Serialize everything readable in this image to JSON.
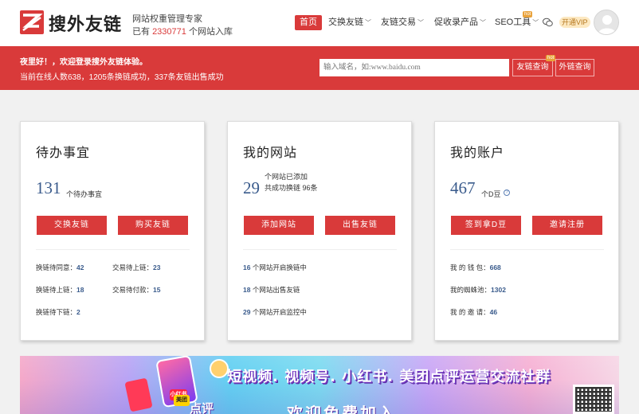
{
  "header": {
    "brand": "搜外友链",
    "slogan1": "网站权重管理专家",
    "slogan2_prefix": "已有",
    "slogan2_number": "2330771",
    "slogan2_suffix": "个网站入库",
    "nav": [
      {
        "label": "首页",
        "active": true
      },
      {
        "label": "交换友链",
        "dropdown": true
      },
      {
        "label": "友链交易",
        "dropdown": true
      },
      {
        "label": "促收录产品",
        "dropdown": true
      },
      {
        "label": "SEO工具",
        "dropdown": true
      }
    ],
    "hot_badge": "hot",
    "vip_label": "开通VIP",
    "accent_color": "#d93a3a"
  },
  "banner": {
    "greeting": "夜里好！，欢迎登录搜外友链体验。",
    "stats": "当前在线人数638，1205条换链成功，337条友链出售成功",
    "search_placeholder": "输入域名，如:www.baidu.com",
    "btn_friend": "友链查询",
    "btn_outer": "外链查询",
    "btn_hot": "hot"
  },
  "cards": {
    "todo": {
      "title": "待办事宜",
      "number": "131",
      "number_label": "个待办事宜",
      "btn1": "交换友链",
      "btn2": "购买友链",
      "stats": [
        {
          "label": "换链待同意：",
          "value": "42"
        },
        {
          "label": "交易待上链：",
          "value": "23"
        },
        {
          "label": "换链待上链：",
          "value": "18"
        },
        {
          "label": "交易待付款：",
          "value": "15"
        },
        {
          "label": "换链待下链：",
          "value": "2"
        }
      ]
    },
    "sites": {
      "title": "我的网站",
      "number": "29",
      "number_label1": "个网站已添加",
      "number_label2": "共成功换链 96条",
      "btn1": "添加网站",
      "btn2": "出售友链",
      "stats": [
        {
          "value": "16",
          "label": "个网站开启换链中"
        },
        {
          "value": "18",
          "label": "个网站出售友链"
        },
        {
          "value": "29",
          "label": "个网站开启监控中"
        }
      ]
    },
    "account": {
      "title": "我的账户",
      "number": "467",
      "number_label": "个D豆",
      "help": "?",
      "btn1": "签到拿D豆",
      "btn2": "邀请注册",
      "stats": [
        {
          "label": "我 的 钱 包：",
          "value": "668"
        },
        {
          "label": "我的蜘蛛池：",
          "value": "1302"
        },
        {
          "label": "我 的 邀 请：",
          "value": "46"
        }
      ]
    }
  },
  "ad": {
    "title": "短视频. 视频号. 小红书. 美团点评运营交流社群",
    "subtitle": "欢迎免费加入",
    "tag_xhs": "小红书",
    "tag_mt": "美团",
    "dianping": "点评"
  }
}
